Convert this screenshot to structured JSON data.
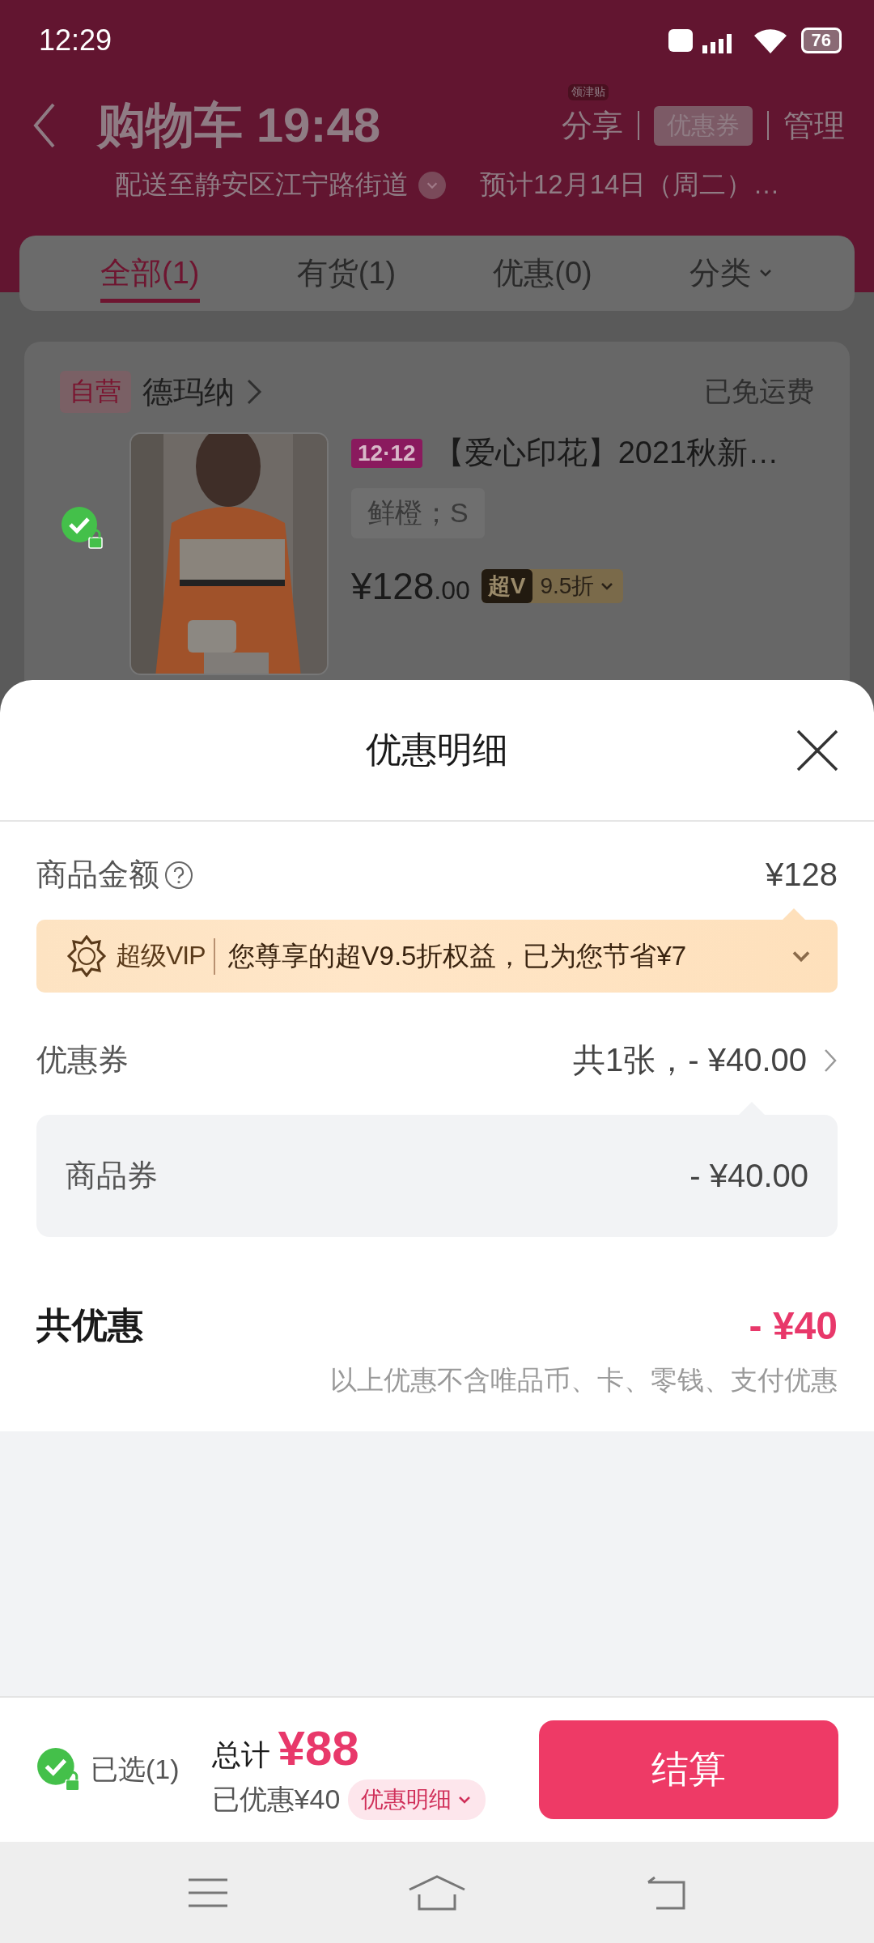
{
  "status_bar": {
    "time": "12:29",
    "battery": "76"
  },
  "header": {
    "title": "购物车 19:48",
    "share_badge": "领津贴",
    "actions": [
      {
        "label": "分享",
        "kind": "text"
      },
      {
        "label": "优惠券",
        "kind": "ticket"
      },
      {
        "label": "管理",
        "kind": "text"
      }
    ],
    "address": "配送至静安区江宁路街道",
    "eta": "预计12月14日（周二）…"
  },
  "tabs": [
    {
      "label": "全部(1)",
      "selected": true,
      "has_caret": false
    },
    {
      "label": "有货(1)",
      "selected": false,
      "has_caret": false
    },
    {
      "label": "优惠(0)",
      "selected": false,
      "has_caret": false
    },
    {
      "label": "分类",
      "selected": false,
      "has_caret": true
    }
  ],
  "store": {
    "tag": "自营",
    "name": "德玛纳",
    "shipping": "已免运费",
    "item": {
      "checked": true,
      "promo_badge": "12·12",
      "title": "【爱心印花】2021秋新…",
      "spec": "鲜橙；S",
      "price": "¥128",
      "price_decimal": ".00",
      "vip_tag": "超V",
      "discount": "9.5折"
    }
  },
  "sheet": {
    "title": "优惠明细",
    "goods": {
      "label": "商品金额",
      "amount": "¥128"
    },
    "vip": {
      "brand": "超级VIP",
      "text": "您尊享的超V9.5折权益，已为您节省¥7"
    },
    "coupons": {
      "label": "优惠券",
      "summary": "共1张，- ¥40.00",
      "items": [
        {
          "label": "商品券",
          "amount": "- ¥40.00"
        }
      ]
    },
    "total": {
      "label": "共优惠",
      "amount": "- ¥40",
      "note": "以上优惠不含唯品币、卡、零钱、支付优惠"
    }
  },
  "bottom": {
    "selected_label": "已选(1)",
    "checked": true,
    "total_label": "总计",
    "total": "¥88",
    "saved": "已优惠¥40",
    "detail_button": "优惠明细",
    "checkout": "结算"
  }
}
